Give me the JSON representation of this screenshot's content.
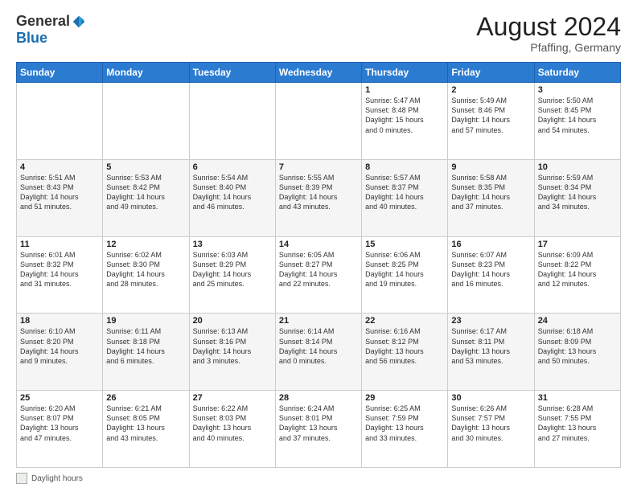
{
  "header": {
    "logo_general": "General",
    "logo_blue": "Blue",
    "month_year": "August 2024",
    "location": "Pfaffing, Germany"
  },
  "footer": {
    "daylight_label": "Daylight hours"
  },
  "days_of_week": [
    "Sunday",
    "Monday",
    "Tuesday",
    "Wednesday",
    "Thursday",
    "Friday",
    "Saturday"
  ],
  "weeks": [
    [
      {
        "day": "",
        "info": ""
      },
      {
        "day": "",
        "info": ""
      },
      {
        "day": "",
        "info": ""
      },
      {
        "day": "",
        "info": ""
      },
      {
        "day": "1",
        "info": "Sunrise: 5:47 AM\nSunset: 8:48 PM\nDaylight: 15 hours\nand 0 minutes."
      },
      {
        "day": "2",
        "info": "Sunrise: 5:49 AM\nSunset: 8:46 PM\nDaylight: 14 hours\nand 57 minutes."
      },
      {
        "day": "3",
        "info": "Sunrise: 5:50 AM\nSunset: 8:45 PM\nDaylight: 14 hours\nand 54 minutes."
      }
    ],
    [
      {
        "day": "4",
        "info": "Sunrise: 5:51 AM\nSunset: 8:43 PM\nDaylight: 14 hours\nand 51 minutes."
      },
      {
        "day": "5",
        "info": "Sunrise: 5:53 AM\nSunset: 8:42 PM\nDaylight: 14 hours\nand 49 minutes."
      },
      {
        "day": "6",
        "info": "Sunrise: 5:54 AM\nSunset: 8:40 PM\nDaylight: 14 hours\nand 46 minutes."
      },
      {
        "day": "7",
        "info": "Sunrise: 5:55 AM\nSunset: 8:39 PM\nDaylight: 14 hours\nand 43 minutes."
      },
      {
        "day": "8",
        "info": "Sunrise: 5:57 AM\nSunset: 8:37 PM\nDaylight: 14 hours\nand 40 minutes."
      },
      {
        "day": "9",
        "info": "Sunrise: 5:58 AM\nSunset: 8:35 PM\nDaylight: 14 hours\nand 37 minutes."
      },
      {
        "day": "10",
        "info": "Sunrise: 5:59 AM\nSunset: 8:34 PM\nDaylight: 14 hours\nand 34 minutes."
      }
    ],
    [
      {
        "day": "11",
        "info": "Sunrise: 6:01 AM\nSunset: 8:32 PM\nDaylight: 14 hours\nand 31 minutes."
      },
      {
        "day": "12",
        "info": "Sunrise: 6:02 AM\nSunset: 8:30 PM\nDaylight: 14 hours\nand 28 minutes."
      },
      {
        "day": "13",
        "info": "Sunrise: 6:03 AM\nSunset: 8:29 PM\nDaylight: 14 hours\nand 25 minutes."
      },
      {
        "day": "14",
        "info": "Sunrise: 6:05 AM\nSunset: 8:27 PM\nDaylight: 14 hours\nand 22 minutes."
      },
      {
        "day": "15",
        "info": "Sunrise: 6:06 AM\nSunset: 8:25 PM\nDaylight: 14 hours\nand 19 minutes."
      },
      {
        "day": "16",
        "info": "Sunrise: 6:07 AM\nSunset: 8:23 PM\nDaylight: 14 hours\nand 16 minutes."
      },
      {
        "day": "17",
        "info": "Sunrise: 6:09 AM\nSunset: 8:22 PM\nDaylight: 14 hours\nand 12 minutes."
      }
    ],
    [
      {
        "day": "18",
        "info": "Sunrise: 6:10 AM\nSunset: 8:20 PM\nDaylight: 14 hours\nand 9 minutes."
      },
      {
        "day": "19",
        "info": "Sunrise: 6:11 AM\nSunset: 8:18 PM\nDaylight: 14 hours\nand 6 minutes."
      },
      {
        "day": "20",
        "info": "Sunrise: 6:13 AM\nSunset: 8:16 PM\nDaylight: 14 hours\nand 3 minutes."
      },
      {
        "day": "21",
        "info": "Sunrise: 6:14 AM\nSunset: 8:14 PM\nDaylight: 14 hours\nand 0 minutes."
      },
      {
        "day": "22",
        "info": "Sunrise: 6:16 AM\nSunset: 8:12 PM\nDaylight: 13 hours\nand 56 minutes."
      },
      {
        "day": "23",
        "info": "Sunrise: 6:17 AM\nSunset: 8:11 PM\nDaylight: 13 hours\nand 53 minutes."
      },
      {
        "day": "24",
        "info": "Sunrise: 6:18 AM\nSunset: 8:09 PM\nDaylight: 13 hours\nand 50 minutes."
      }
    ],
    [
      {
        "day": "25",
        "info": "Sunrise: 6:20 AM\nSunset: 8:07 PM\nDaylight: 13 hours\nand 47 minutes."
      },
      {
        "day": "26",
        "info": "Sunrise: 6:21 AM\nSunset: 8:05 PM\nDaylight: 13 hours\nand 43 minutes."
      },
      {
        "day": "27",
        "info": "Sunrise: 6:22 AM\nSunset: 8:03 PM\nDaylight: 13 hours\nand 40 minutes."
      },
      {
        "day": "28",
        "info": "Sunrise: 6:24 AM\nSunset: 8:01 PM\nDaylight: 13 hours\nand 37 minutes."
      },
      {
        "day": "29",
        "info": "Sunrise: 6:25 AM\nSunset: 7:59 PM\nDaylight: 13 hours\nand 33 minutes."
      },
      {
        "day": "30",
        "info": "Sunrise: 6:26 AM\nSunset: 7:57 PM\nDaylight: 13 hours\nand 30 minutes."
      },
      {
        "day": "31",
        "info": "Sunrise: 6:28 AM\nSunset: 7:55 PM\nDaylight: 13 hours\nand 27 minutes."
      }
    ]
  ]
}
